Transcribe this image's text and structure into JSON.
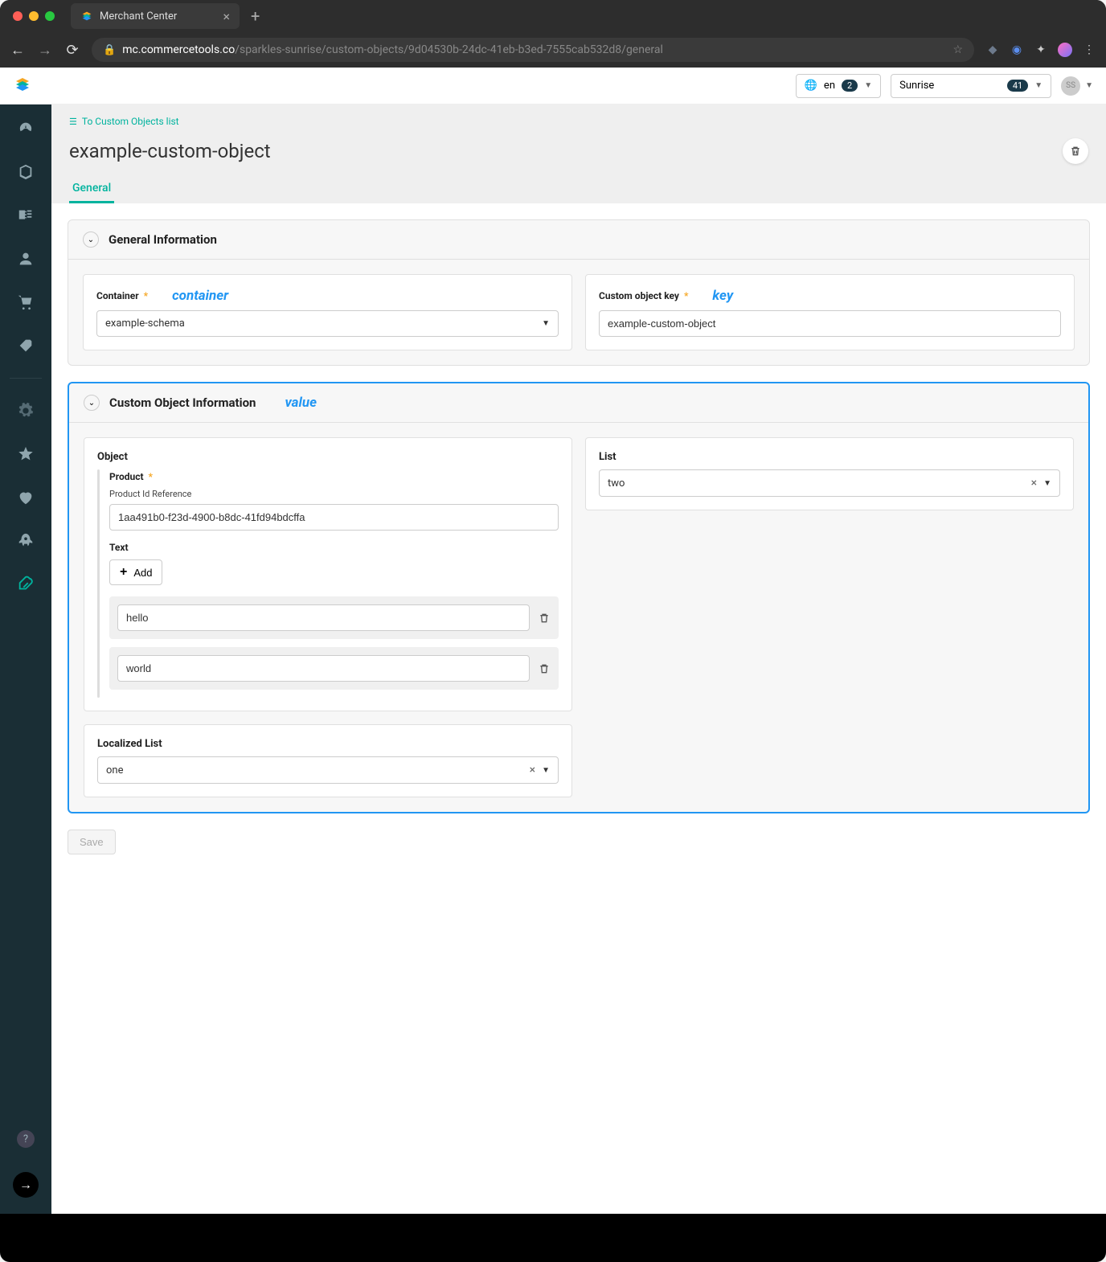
{
  "browser": {
    "tab_title": "Merchant Center",
    "url_host": "mc.commercetools.co",
    "url_path": "/sparkles-sunrise/custom-objects/9d04530b-24dc-41eb-b3ed-7555cab532d8/general"
  },
  "topbar": {
    "lang": "en",
    "lang_badge": "2",
    "project": "Sunrise",
    "project_badge": "41",
    "avatar": "SS"
  },
  "breadcrumb": {
    "back_label": "To Custom Objects list"
  },
  "page": {
    "title": "example-custom-object",
    "tab_general": "General",
    "save_label": "Save"
  },
  "panel1": {
    "title": "General Information",
    "container_label": "Container",
    "container_value": "example-schema",
    "key_label": "Custom object key",
    "key_value": "example-custom-object",
    "annot_container": "container",
    "annot_key": "key"
  },
  "panel2": {
    "title": "Custom Object Information",
    "annot_value": "value",
    "object_label": "Object",
    "product_label": "Product",
    "product_sub": "Product Id Reference",
    "product_value": "1aa491b0-f23d-4900-b8dc-41fd94bdcffa",
    "text_label": "Text",
    "add_label": "Add",
    "text_items": [
      "hello",
      "world"
    ],
    "localized_label": "Localized List",
    "localized_value": "one",
    "list_label": "List",
    "list_value": "two"
  }
}
